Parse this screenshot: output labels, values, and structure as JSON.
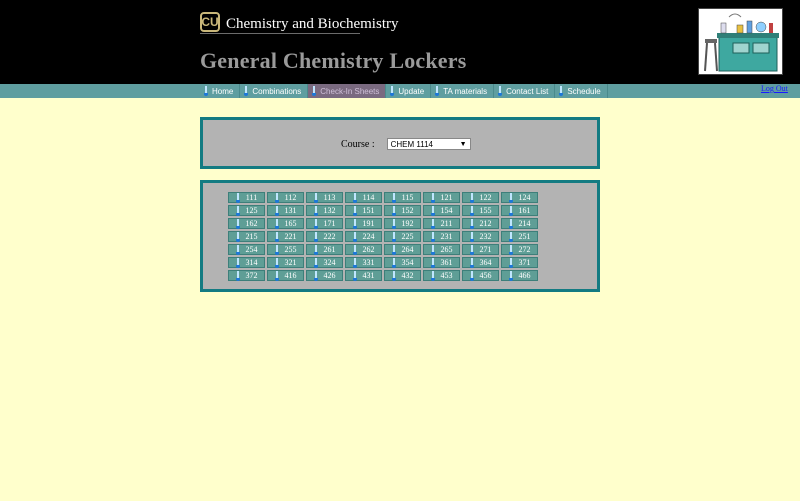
{
  "header": {
    "department": "Chemistry and Biochemistry",
    "title": "General Chemistry Lockers",
    "logo_text": "CU"
  },
  "nav": {
    "items": [
      "Home",
      "Combinations",
      "Check-In Sheets",
      "Update",
      "TA materials",
      "Contact List",
      "Schedule"
    ],
    "active": "Check-In Sheets",
    "logout": "Log Out"
  },
  "course": {
    "label": "Course :",
    "selected": "CHEM 1114"
  },
  "lockers": [
    "111",
    "112",
    "113",
    "114",
    "115",
    "121",
    "122",
    "124",
    "125",
    "131",
    "132",
    "151",
    "152",
    "154",
    "155",
    "161",
    "162",
    "165",
    "171",
    "191",
    "192",
    "211",
    "212",
    "214",
    "215",
    "221",
    "222",
    "224",
    "225",
    "231",
    "232",
    "251",
    "254",
    "255",
    "261",
    "262",
    "264",
    "265",
    "271",
    "272",
    "314",
    "321",
    "324",
    "331",
    "354",
    "361",
    "364",
    "371",
    "372",
    "416",
    "426",
    "431",
    "432",
    "453",
    "456",
    "466"
  ]
}
